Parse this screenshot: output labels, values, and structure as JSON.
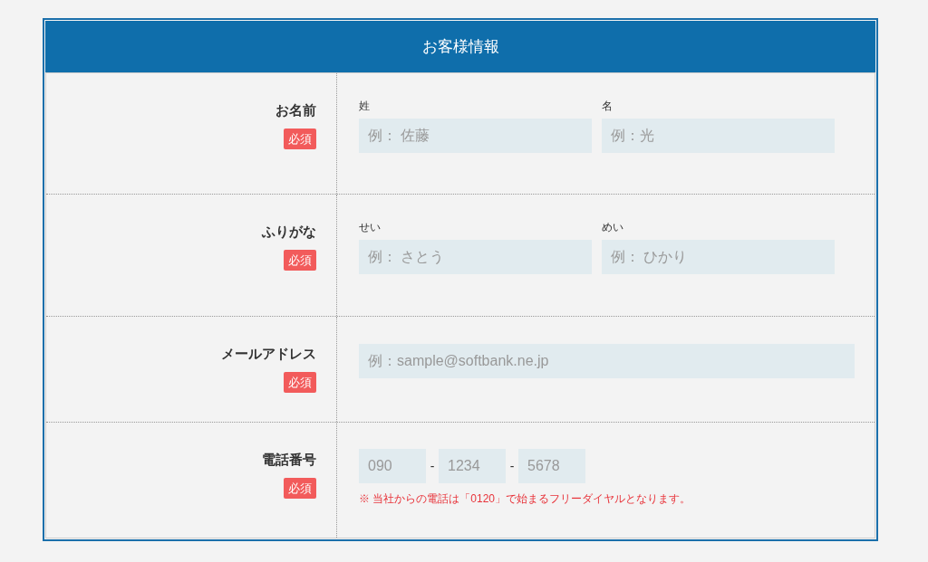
{
  "form": {
    "title": "お客様情報",
    "rows": [
      {
        "kind": "split",
        "label": "お名前",
        "badge": "必須",
        "fields": [
          {
            "label": "姓",
            "placeholder": "例： 佐藤"
          },
          {
            "label": "名",
            "placeholder": "例：光"
          }
        ]
      },
      {
        "kind": "split",
        "label": "ふりがな",
        "badge": "必須",
        "fields": [
          {
            "label": "せい",
            "placeholder": "例： さとう"
          },
          {
            "label": "めい",
            "placeholder": "例： ひかり"
          }
        ]
      },
      {
        "kind": "single",
        "label": "メールアドレス",
        "badge": "必須",
        "placeholder": "例：sample@softbank.ne.jp"
      },
      {
        "kind": "phone",
        "label": "電話番号",
        "badge": "必須",
        "parts": [
          {
            "placeholder": "090"
          },
          {
            "separator": "-",
            "placeholder": "1234"
          },
          {
            "separator": "-",
            "placeholder": "5678"
          }
        ],
        "note": "※ 当社からの電話は「0120」で始まるフリーダイヤルとなります。"
      }
    ]
  }
}
